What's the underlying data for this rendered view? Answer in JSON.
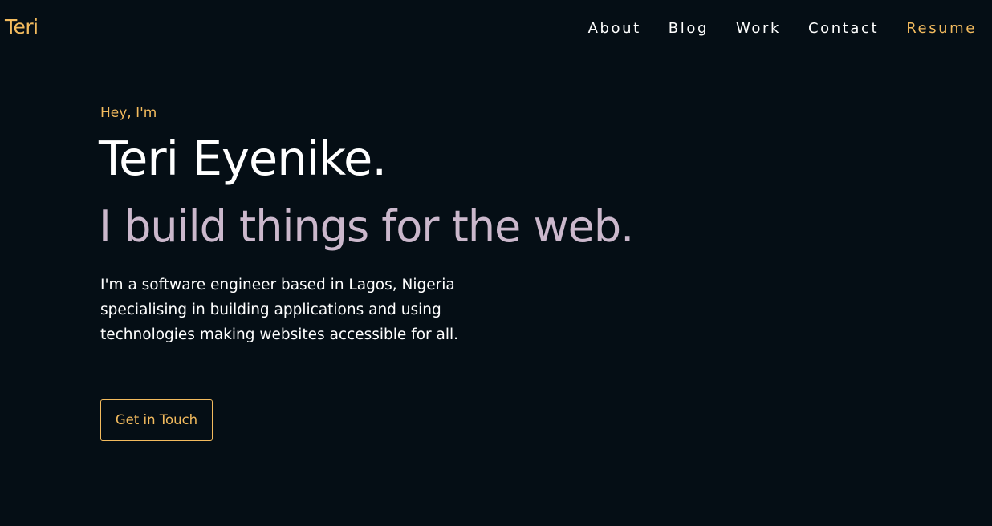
{
  "header": {
    "logo": "Teri",
    "nav": [
      {
        "label": "About"
      },
      {
        "label": "Blog"
      },
      {
        "label": "Work"
      },
      {
        "label": "Contact"
      },
      {
        "label": "Resume"
      }
    ]
  },
  "hero": {
    "greeting": "Hey, I'm",
    "name": "Teri Eyenike.",
    "tagline": "I build things for the web.",
    "bio": "I'm a software engineer based in Lagos, Nigeria specialising in building applications and using technologies making websites accessible for all.",
    "cta_label": "Get in Touch"
  },
  "colors": {
    "background": "#050e15",
    "accent": "#f3bb5e",
    "tagline": "#cbb8cc",
    "text": "#ffffff"
  }
}
